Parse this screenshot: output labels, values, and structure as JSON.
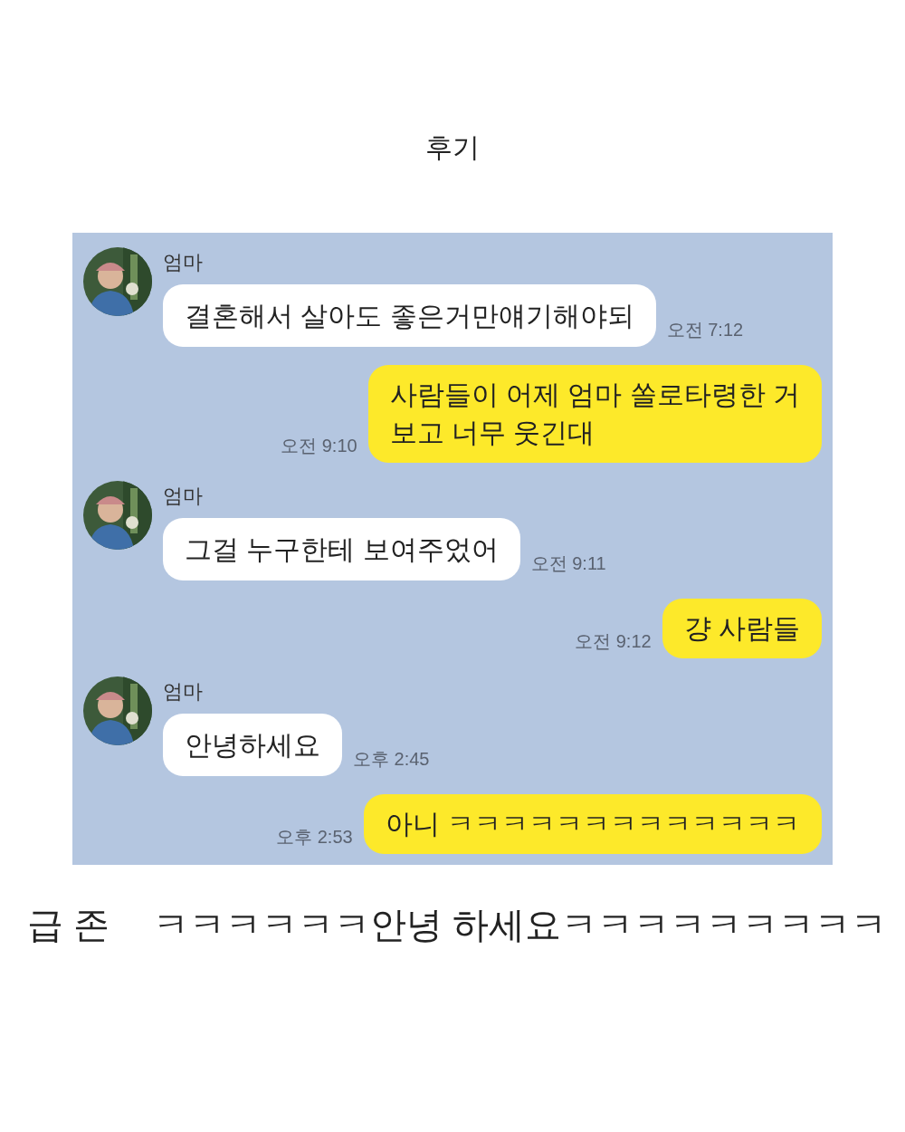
{
  "title": "후기",
  "messages": [
    {
      "kind": "received",
      "sender": "엄마",
      "text": "결혼해서 살아도  좋은거만얘기해야되",
      "time": "오전 7:12"
    },
    {
      "kind": "sent",
      "lines": [
        "사람들이 어제 엄마 쏠로타령한 거",
        "보고 너무 웃긴대"
      ],
      "time": "오전 9:10"
    },
    {
      "kind": "received",
      "sender": "엄마",
      "text": "그걸 누구한테 보여주었어",
      "time": "오전 9:11"
    },
    {
      "kind": "sent",
      "lines": [
        "걍 사람들"
      ],
      "time": "오전 9:12"
    },
    {
      "kind": "received",
      "sender": "엄마",
      "text": "안녕하세요",
      "time": "오후 2:45"
    },
    {
      "kind": "sent",
      "lines": [
        "아니 ㅋㅋㅋㅋㅋㅋㅋㅋㅋㅋㅋㅋㅋ"
      ],
      "time": "오후 2:53"
    }
  ],
  "caption": [
    "급 존",
    "ㅋㅋㅋㅋㅋㅋ안녕 하세요ㅋㅋㅋㅋㅋㅋㅋㅋㅋ"
  ]
}
